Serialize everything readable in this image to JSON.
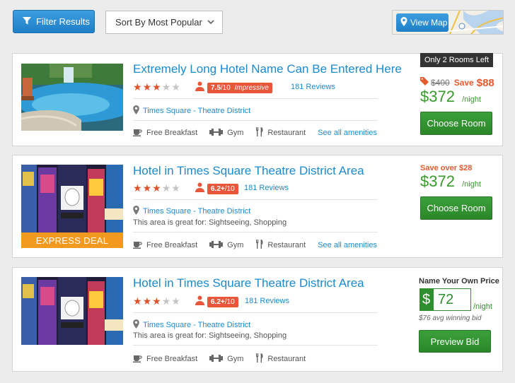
{
  "toolbar": {
    "filter_label": "Filter Results",
    "sort_label": "Sort By Most Popular",
    "map_label": "View Map"
  },
  "colors": {
    "accent_blue": "#1a8bd0",
    "button_green": "#2f8f2e",
    "badge_orange": "#e8573a",
    "save_orange": "#e55a2e"
  },
  "hotels": [
    {
      "banner": "Only 2 Rooms Left",
      "title": "Extremely Long Hotel Name Can Be Entered Here",
      "stars": 3,
      "rating_score": "7.5",
      "rating_scale": "/10",
      "rating_word": "Impressive",
      "reviews": "181 Reviews",
      "location": "Times Square - Theatre District",
      "amenities": [
        "Free Breakfast",
        "Gym",
        "Restaurant"
      ],
      "see_all": "See all amenities",
      "old_price": "$400",
      "save_label": "Save",
      "save_amount": "$88",
      "price": "$372",
      "per_night": "/night",
      "button": "Choose Room"
    },
    {
      "badge": "EXPRESS DEAL",
      "title": "Hotel in Times Square Theatre District Area",
      "stars": 3,
      "rating_score": "6.2+",
      "rating_scale": "/10",
      "reviews": "181 Reviews",
      "location": "Times Square - Theatre District",
      "great_for": "This area is great for: Sightseeing, Shopping",
      "amenities": [
        "Free Breakfast",
        "Gym",
        "Restaurant"
      ],
      "see_all": "See all amenities",
      "save_over": "Save over $28",
      "price": "$372",
      "per_night": "/night",
      "button": "Choose Room"
    },
    {
      "title": "Hotel in Times Square Theatre District Area",
      "stars": 3,
      "rating_score": "6.2+",
      "rating_scale": "/10",
      "reviews": "181 Reviews",
      "location": "Times Square - Theatre District",
      "great_for": "This area is great for: Sightseeing, Shopping",
      "amenities": [
        "Free Breakfast",
        "Gym",
        "Restaurant"
      ],
      "nyop_title": "Name Your Own Price",
      "currency": "$",
      "bid_value": "72",
      "per_night": "/night",
      "avg_bid": "$76 avg winning bid",
      "button": "Preview Bid"
    }
  ]
}
